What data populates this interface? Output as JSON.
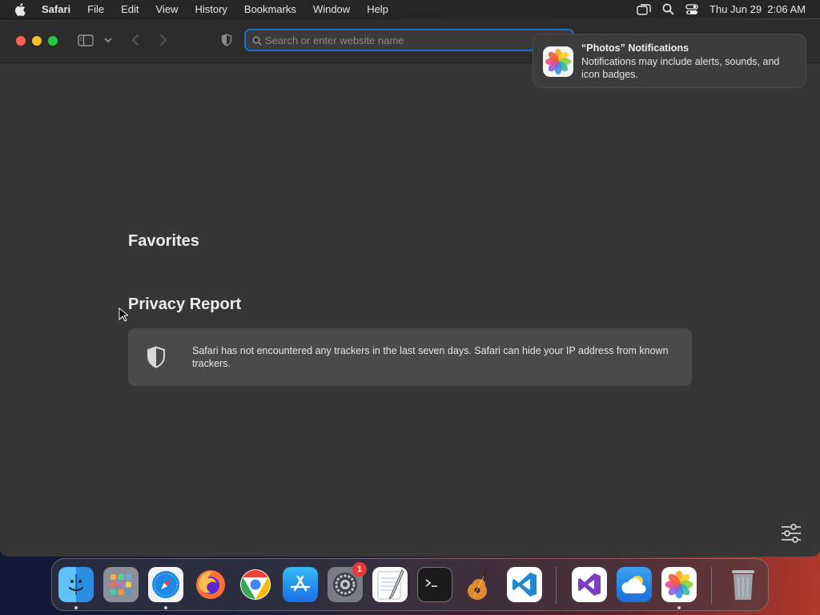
{
  "menubar": {
    "items": [
      "Safari",
      "File",
      "Edit",
      "View",
      "History",
      "Bookmarks",
      "Window",
      "Help"
    ],
    "clock": "Thu Jun 29  2:06 AM"
  },
  "toolbar": {
    "address_placeholder": "Search or enter website name",
    "address_value": ""
  },
  "content": {
    "favorites_title": "Favorites",
    "privacy_title": "Privacy Report",
    "privacy_text": "Safari has not encountered any trackers in the last seven days. Safari can hide your IP address from known trackers."
  },
  "notification": {
    "title": "“Photos” Notifications",
    "body": "Notifications may include alerts, sounds, and icon badges."
  },
  "dock": {
    "apps": [
      "Finder",
      "Launchpad",
      "Safari",
      "Firefox",
      "Google Chrome",
      "App Store",
      "System Settings",
      "TextEdit",
      "Terminal",
      "GarageBand",
      "Visual Studio Code",
      "Visual Studio",
      "Weather",
      "Photos",
      "Trash"
    ],
    "settings_badge": "1"
  },
  "colors": {
    "accent": "#1f6fd0",
    "window_bg": "#363636",
    "toolbar_bg": "#2c2c2c",
    "close": "#ff5f57",
    "minimize": "#febc2e",
    "zoom": "#28c840"
  },
  "icons": [
    "apple-icon",
    "screen-mirroring-icon",
    "spotlight-search-icon",
    "control-center-icon",
    "sidebar-icon",
    "chevron-down-icon",
    "back-icon",
    "forward-icon",
    "privacy-shield-icon",
    "magnifier-icon",
    "shield-icon",
    "customize-icon"
  ]
}
